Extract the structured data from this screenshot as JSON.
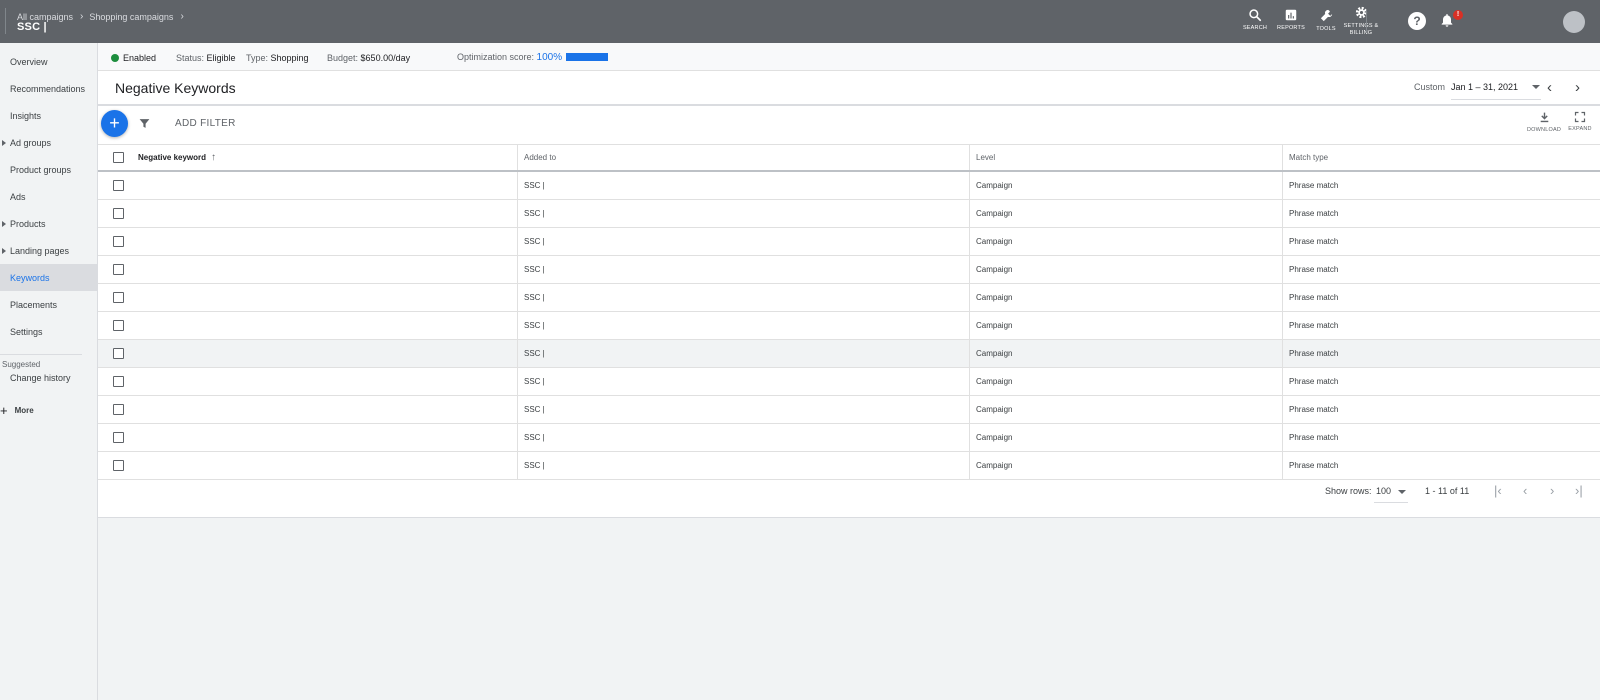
{
  "header": {
    "breadcrumbs": [
      "All campaigns",
      "Shopping campaigns"
    ],
    "account": "SSC |",
    "tools": [
      {
        "icon": "search-icon",
        "label": "SEARCH"
      },
      {
        "icon": "reports-icon",
        "label": "REPORTS"
      },
      {
        "icon": "tools-icon",
        "label": "TOOLS"
      },
      {
        "icon": "settings-icon",
        "label1": "SETTINGS &",
        "label2": "BILLING"
      }
    ],
    "notification_badge": "!"
  },
  "sidebar": {
    "items": [
      {
        "label": "Overview"
      },
      {
        "label": "Recommendations"
      },
      {
        "label": "Insights"
      },
      {
        "label": "Ad groups"
      },
      {
        "label": "Product groups"
      },
      {
        "label": "Ads"
      },
      {
        "label": "Products"
      },
      {
        "label": "Landing pages"
      },
      {
        "label": "Keywords"
      },
      {
        "label": "Placements"
      },
      {
        "label": "Settings"
      }
    ],
    "suggested_label": "Suggested",
    "change_history": "Change history",
    "more_label": "More"
  },
  "status": {
    "enabled": "Enabled",
    "status_label": "Status:",
    "status_value": "Eligible",
    "type_label": "Type:",
    "type_value": "Shopping",
    "budget_label": "Budget:",
    "budget_value": "$650.00/day",
    "opt_label": "Optimization score:",
    "opt_value": "100%"
  },
  "page": {
    "title": "Negative Keywords",
    "date_label": "Custom",
    "date_value": "Jan 1 – 31, 2021",
    "add_filter": "ADD FILTER",
    "download": "DOWNLOAD",
    "expand": "EXPAND"
  },
  "table": {
    "headers": {
      "keyword": "Negative keyword",
      "added_to": "Added to",
      "level": "Level",
      "match_type": "Match type"
    },
    "rows": [
      {
        "keyword": "",
        "added_to": "SSC |",
        "level": "Campaign",
        "match_type": "Phrase match"
      },
      {
        "keyword": "",
        "added_to": "SSC |",
        "level": "Campaign",
        "match_type": "Phrase match"
      },
      {
        "keyword": "",
        "added_to": "SSC |",
        "level": "Campaign",
        "match_type": "Phrase match"
      },
      {
        "keyword": "",
        "added_to": "SSC |",
        "level": "Campaign",
        "match_type": "Phrase match"
      },
      {
        "keyword": "",
        "added_to": "SSC |",
        "level": "Campaign",
        "match_type": "Phrase match"
      },
      {
        "keyword": "",
        "added_to": "SSC |",
        "level": "Campaign",
        "match_type": "Phrase match"
      },
      {
        "keyword": "",
        "added_to": "SSC |",
        "level": "Campaign",
        "match_type": "Phrase match"
      },
      {
        "keyword": "",
        "added_to": "SSC |",
        "level": "Campaign",
        "match_type": "Phrase match"
      },
      {
        "keyword": "",
        "added_to": "SSC |",
        "level": "Campaign",
        "match_type": "Phrase match"
      },
      {
        "keyword": "",
        "added_to": "SSC |",
        "level": "Campaign",
        "match_type": "Phrase match"
      },
      {
        "keyword": "",
        "added_to": "SSC |",
        "level": "Campaign",
        "match_type": "Phrase match"
      }
    ]
  },
  "pagination": {
    "show_rows_label": "Show rows:",
    "rows_value": "100",
    "range": "1 - 11 of 11"
  },
  "colors": {
    "topbar": "#5f6368",
    "accent": "#1a73e8",
    "enabled": "#1e8e3e",
    "badge": "#d93025"
  }
}
